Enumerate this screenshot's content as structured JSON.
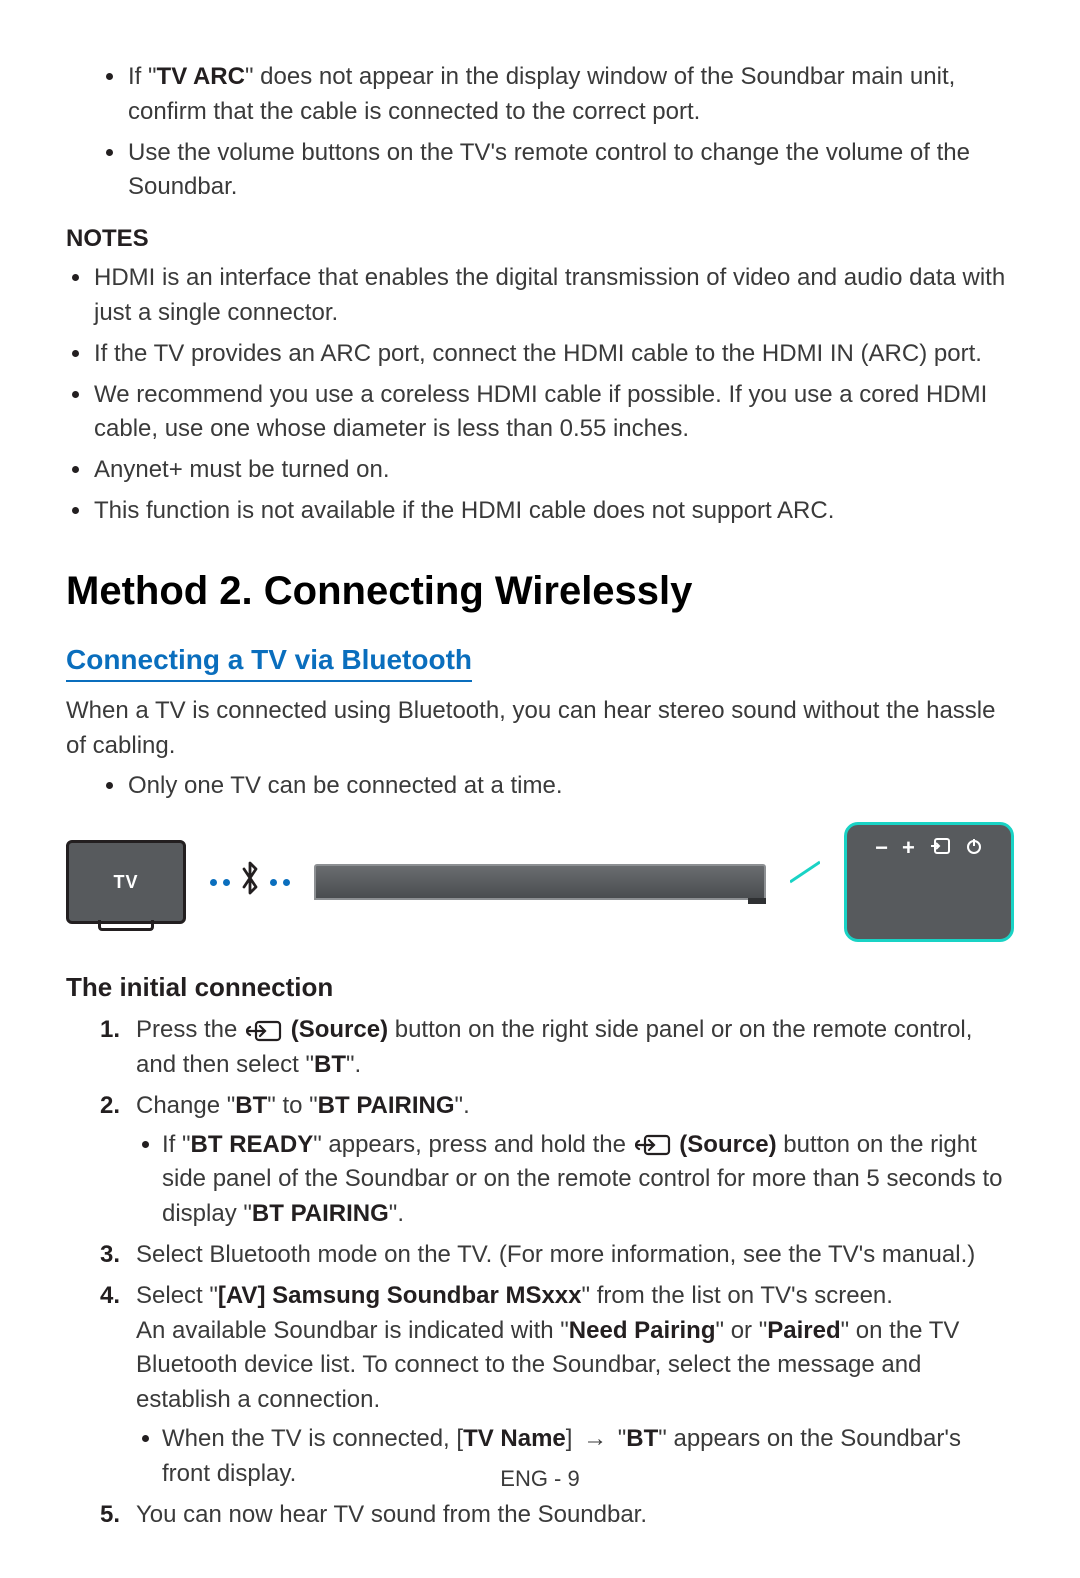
{
  "top_bullets": [
    {
      "pre": "If \"",
      "bold": "TV ARC",
      "post": "\" does not appear in the display window of the Soundbar main unit, confirm that the cable is connected to the correct port."
    },
    {
      "pre": "",
      "bold": "",
      "post": "Use the volume buttons on the TV's remote control to change the volume of the Soundbar."
    }
  ],
  "notes_heading": "NOTES",
  "notes": [
    "HDMI is an interface that enables the digital transmission of video and audio data with just a single connector.",
    "If the TV provides an ARC port, connect the HDMI cable to the HDMI IN (ARC) port.",
    "We recommend you use a coreless HDMI cable if possible. If you use a cored HDMI cable, use one whose diameter is less than 0.55 inches.",
    "Anynet+ must be turned on.",
    "This function is not available if the HDMI cable does not support ARC."
  ],
  "method_heading": "Method 2. Connecting Wirelessly",
  "bt_heading": "Connecting a TV via Bluetooth",
  "bt_intro": "When a TV is connected using Bluetooth, you can hear stereo sound without the hassle of cabling.",
  "bt_sub_bullet": "Only one TV can be connected at a time.",
  "diagram": {
    "tv_label": "TV",
    "panel_symbols": [
      "−",
      "+",
      "⮌",
      "⏻"
    ]
  },
  "initial_heading": "The initial connection",
  "steps": {
    "s1": {
      "a": "Press the ",
      "b": " (Source)",
      "c": " button on the right side panel or on the remote control, and then select \"",
      "d": "BT",
      "e": "\"."
    },
    "s2": {
      "a": "Change \"",
      "b": "BT",
      "c": "\" to \"",
      "d": "BT PAIRING",
      "e": "\".",
      "sub": {
        "a": "If \"",
        "b": "BT READY",
        "c": "\" appears, press and hold the ",
        "d": " (Source)",
        "e": " button on the right side panel of the Soundbar or on the remote control for more than 5 seconds to display \"",
        "f": "BT PAIRING",
        "g": "\"."
      }
    },
    "s3": "Select Bluetooth mode on the TV. (For more information, see the TV's manual.)",
    "s4": {
      "a": "Select \"",
      "b": "[AV] Samsung Soundbar MSxxx",
      "c": "\" from the list on TV's screen.",
      "line2a": "An available Soundbar is indicated with \"",
      "line2b": "Need Pairing",
      "line2c": "\" or \"",
      "line2d": "Paired",
      "line2e": "\" on the TV Bluetooth device list. To connect to the Soundbar, select the message and establish a connection.",
      "sub": {
        "a": "When the TV is connected, [",
        "b": "TV Name",
        "c": "] ",
        "arrow": "→",
        "d": " \"",
        "e": "BT",
        "f": "\" appears on the Soundbar's front display."
      }
    },
    "s5": "You can now hear TV sound from the Soundbar."
  },
  "footer": "ENG - 9"
}
